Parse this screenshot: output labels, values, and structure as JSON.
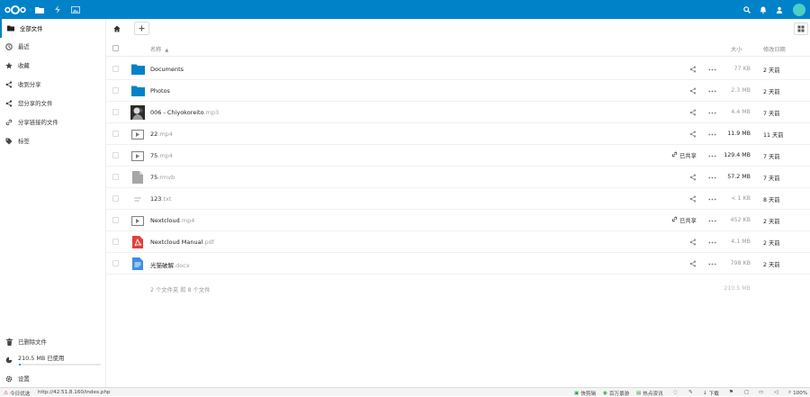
{
  "header": {
    "apps": [
      "files-icon",
      "activity-icon",
      "gallery-icon"
    ],
    "right_icons": [
      "search-icon",
      "notifications-icon",
      "contacts-icon"
    ],
    "avatar_color": "#4dd0c4",
    "brand_color": "#0082c9"
  },
  "sidebar": {
    "items": [
      {
        "label": "全部文件",
        "icon": "folder-icon"
      },
      {
        "label": "最近",
        "icon": "clock-icon"
      },
      {
        "label": "收藏",
        "icon": "star-icon"
      },
      {
        "label": "收到分享",
        "icon": "share-icon"
      },
      {
        "label": "您分享的文件",
        "icon": "share-icon"
      },
      {
        "label": "分享链接的文件",
        "icon": "link-icon"
      },
      {
        "label": "标签",
        "icon": "tag-icon"
      }
    ],
    "trash_label": "已删除文件",
    "quota_label": "210.5 MB 已使用",
    "quota_fraction": 0.02,
    "settings_label": "设置"
  },
  "table": {
    "col_name": "名称",
    "col_size": "大小",
    "col_modified": "修改日期",
    "rows": [
      {
        "name": "Documents",
        "ext": "",
        "type": "folder",
        "size": "77 KB",
        "date": "2 天前",
        "shared": false
      },
      {
        "name": "Photos",
        "ext": "",
        "type": "folder",
        "size": "2.3 MB",
        "date": "2 天前",
        "shared": false
      },
      {
        "name": "006 - Chiyokoreito",
        "ext": ".mp3",
        "type": "image",
        "size": "4.4 MB",
        "date": "7 天前",
        "shared": false
      },
      {
        "name": "22",
        "ext": ".mp4",
        "type": "video",
        "size": "11.9 MB",
        "date": "11 天前",
        "shared": false
      },
      {
        "name": "75",
        "ext": ".mp4",
        "type": "video",
        "size": "129.4 MB",
        "date": "7 天前",
        "shared": true
      },
      {
        "name": "75",
        "ext": ".rmvb",
        "type": "file",
        "size": "57.2 MB",
        "date": "7 天前",
        "shared": false
      },
      {
        "name": "123",
        "ext": ".txt",
        "type": "text",
        "size": "< 1 KB",
        "date": "8 天前",
        "shared": false
      },
      {
        "name": "Nextcloud",
        "ext": ".mp4",
        "type": "video",
        "size": "452 KB",
        "date": "2 天前",
        "shared": true
      },
      {
        "name": "Nextcloud Manual",
        "ext": ".pdf",
        "type": "pdf",
        "size": "4.1 MB",
        "date": "2 天前",
        "shared": false
      },
      {
        "name": "光猫破解",
        "ext": ".docx",
        "type": "doc",
        "size": "798 KB",
        "date": "2 天前",
        "shared": false
      }
    ],
    "shared_label": "已共享",
    "summary": "2 个文件夹 和 8 个文件",
    "summary_size": "210.5 MB"
  },
  "statusbar": {
    "left": "今日优选",
    "url": "http://42.51.8.160/index.php",
    "items": [
      "快剪辑",
      "百万景游",
      "热点资讯",
      "下载"
    ],
    "zoom": "100%"
  }
}
